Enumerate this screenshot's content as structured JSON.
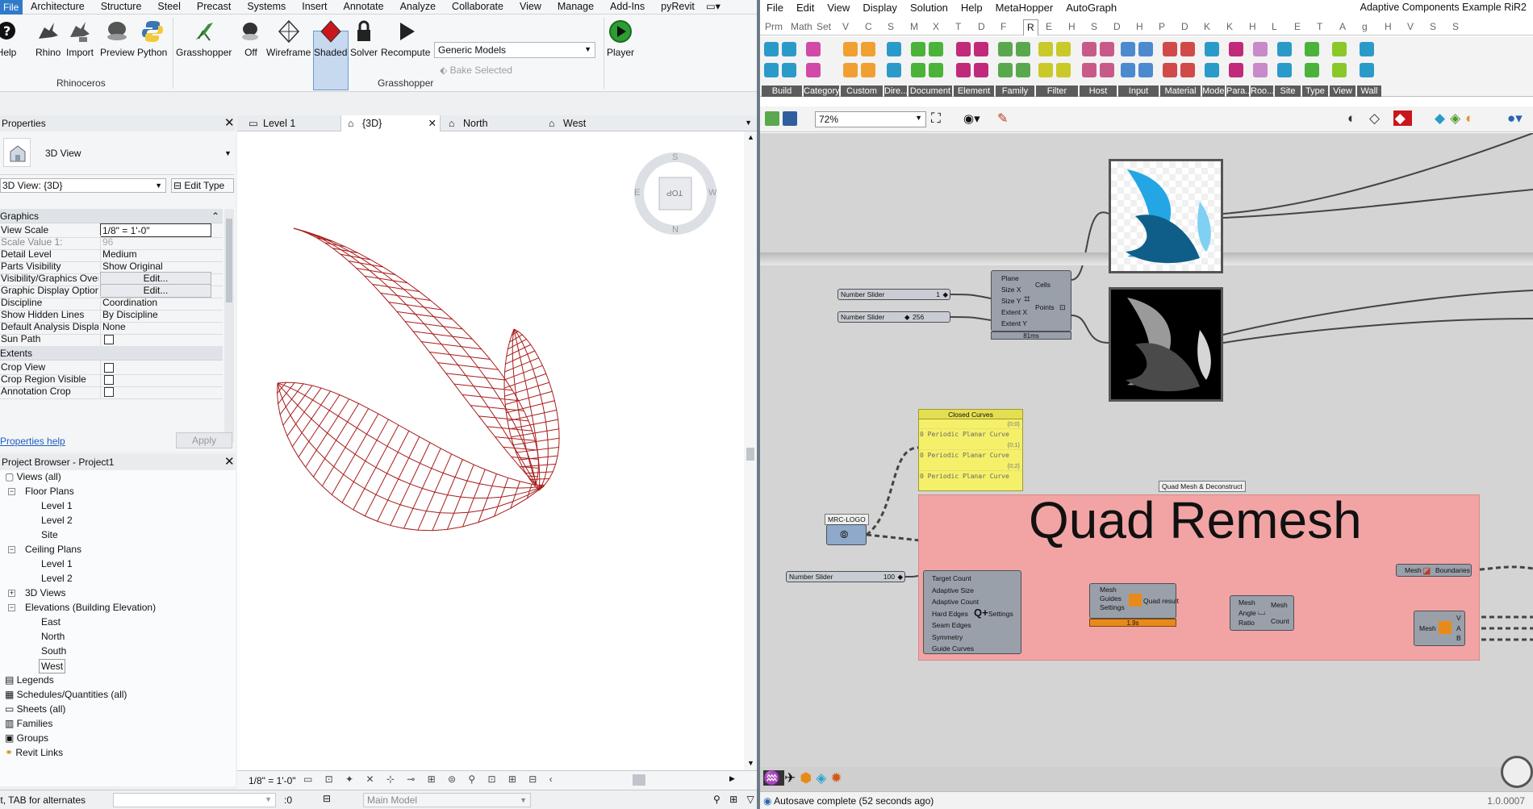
{
  "revit": {
    "menu": {
      "file": "File",
      "tabs": [
        "Architecture",
        "Structure",
        "Steel",
        "Precast",
        "Systems",
        "Insert",
        "Annotate",
        "Analyze",
        "Collaborate",
        "View",
        "Manage",
        "Add-Ins",
        "pyRevit"
      ]
    },
    "ribbon": {
      "help_label": "Help",
      "rhino": {
        "buttons": [
          "Rhino",
          "Import",
          "Preview",
          "Python"
        ],
        "panel": "Rhinoceros"
      },
      "grasshopper": {
        "buttons": [
          "Grasshopper",
          "Off",
          "Wireframe",
          "Shaded",
          "Solver",
          "Recompute"
        ],
        "panel": "Grasshopper",
        "category_select": "Generic Models",
        "bake": "Bake Selected",
        "player": "Player"
      }
    },
    "properties": {
      "title": "Properties",
      "type_name": "3D View",
      "view_selector": "3D View: {3D}",
      "edit_type": "Edit Type",
      "section_graphics": "Graphics",
      "rows": [
        {
          "k": "View Scale",
          "v": "1/8\" = 1'-0\""
        },
        {
          "k": "Scale Value    1:",
          "v": "96"
        },
        {
          "k": "Detail Level",
          "v": "Medium"
        },
        {
          "k": "Parts Visibility",
          "v": "Show Original"
        },
        {
          "k": "Visibility/Graphics Overrides",
          "v": "Edit..."
        },
        {
          "k": "Graphic Display Options",
          "v": "Edit..."
        },
        {
          "k": "Discipline",
          "v": "Coordination"
        },
        {
          "k": "Show Hidden Lines",
          "v": "By Discipline"
        },
        {
          "k": "Default Analysis Display Style",
          "v": "None"
        },
        {
          "k": "Sun Path",
          "v": ""
        }
      ],
      "section_extents": "Extents",
      "extent_rows": [
        {
          "k": "Crop View"
        },
        {
          "k": "Crop Region Visible"
        },
        {
          "k": "Annotation Crop"
        }
      ],
      "help_link": "Properties help",
      "apply": "Apply"
    },
    "browser": {
      "title": "Project Browser - Project1",
      "views": "Views (all)",
      "floor_plans": "Floor Plans",
      "floor_items": [
        "Level 1",
        "Level 2",
        "Site"
      ],
      "ceiling_plans": "Ceiling Plans",
      "ceiling_items": [
        "Level 1",
        "Level 2"
      ],
      "views3d": "3D Views",
      "elevations": "Elevations (Building Elevation)",
      "elev_items": [
        "East",
        "North",
        "South",
        "West"
      ],
      "others": [
        "Legends",
        "Schedules/Quantities (all)",
        "Sheets (all)",
        "Families",
        "Groups",
        "Revit Links"
      ]
    },
    "view_tabs": [
      "Level 1",
      "{3D}",
      "North",
      "West"
    ],
    "viewcube": {
      "face": "TOP",
      "n": "N",
      "s": "S",
      "e": "E",
      "w": "W"
    },
    "view_scale": "1/8\" = 1'-0\"",
    "status": {
      "hint": "Click to select, TAB for alternates",
      "zero": ":0",
      "model": "Main Model"
    }
  },
  "grasshopper": {
    "menu": [
      "File",
      "Edit",
      "View",
      "Display",
      "Solution",
      "Help",
      "MetaHopper",
      "AutoGraph"
    ],
    "window_title": "Adaptive Components Example RiR2",
    "tabs": [
      "Prm",
      "Math",
      "Set",
      "V",
      "C",
      "S",
      "M",
      "X",
      "T",
      "D",
      "F",
      "R",
      "E",
      "H",
      "S",
      "D",
      "H",
      "P",
      "D",
      "K",
      "K",
      "H",
      "L",
      "E",
      "T",
      "A",
      "g",
      "H",
      "V",
      "S",
      "S"
    ],
    "active_tab": "R",
    "categories": [
      "Build",
      "Category",
      "Custom",
      "Dire...",
      "Document",
      "Element",
      "Family",
      "Filter",
      "Host",
      "Input",
      "Material",
      "Model",
      "Para...",
      "Roo...",
      "Site",
      "Type",
      "View",
      "Wall"
    ],
    "zoom": "72%",
    "nodes": {
      "slider1_label": "Number Slider",
      "slider1_value": "1",
      "slider2_label": "Number Slider",
      "slider2_value": "256",
      "hexgrid_inputs": [
        "Plane",
        "Size X",
        "Size Y",
        "Extent X",
        "Extent Y"
      ],
      "hexgrid_outputs": [
        "Cells",
        "Points"
      ],
      "hexgrid_time": "81ms",
      "panel_title": "Closed Curves",
      "panel_paths": [
        "{0;0}",
        "{0;1}",
        "{0;2}"
      ],
      "panel_lines": [
        "0 Periodic Planar Curve",
        "0 Periodic Planar Curve",
        "0 Periodic Planar Curve"
      ],
      "group_title": "Quad Mesh & Deconstruct",
      "group_label": "Quad Remesh",
      "logo_label": "MRC-LOGO",
      "slider3_label": "Number Slider",
      "slider3_value": "100",
      "settings_inputs": [
        "Target Count",
        "Adaptive Size",
        "Adaptive Count",
        "Hard Edges",
        "Seam Edges",
        "Symmetry",
        "Guide Curves"
      ],
      "settings_output": "Settings",
      "remesh_inputs": [
        "Mesh",
        "Guides",
        "Settings"
      ],
      "remesh_output": "Quad result",
      "remesh_time": "1.9s",
      "planar_inputs": [
        "Mesh",
        "Angle",
        "Ratio"
      ],
      "planar_outputs": [
        "Mesh",
        "Count"
      ],
      "bounds_input": "Mesh",
      "bounds_output": "Boundaries",
      "face_input": "Mesh",
      "face_outputs": [
        "V",
        "A",
        "B"
      ]
    },
    "status": "Autosave complete (52 seconds ago)",
    "version": "1.0.0007"
  }
}
